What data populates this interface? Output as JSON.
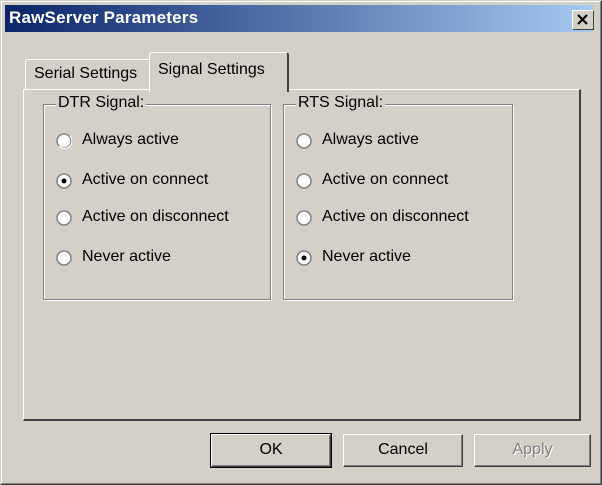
{
  "window": {
    "title": "RawServer Parameters"
  },
  "tabs": [
    {
      "label": "Serial Settings",
      "active": false
    },
    {
      "label": "Signal Settings",
      "active": true
    }
  ],
  "dtr": {
    "label": "DTR Signal:",
    "options": [
      {
        "label": "Always active",
        "checked": false
      },
      {
        "label": "Active on connect",
        "checked": true
      },
      {
        "label": "Active on disconnect",
        "checked": false
      },
      {
        "label": "Never active",
        "checked": false
      }
    ]
  },
  "rts": {
    "label": "RTS Signal:",
    "options": [
      {
        "label": "Always active",
        "checked": false
      },
      {
        "label": "Active on connect",
        "checked": false
      },
      {
        "label": "Active on disconnect",
        "checked": false
      },
      {
        "label": "Never active",
        "checked": true
      }
    ]
  },
  "buttons": {
    "ok": "OK",
    "cancel": "Cancel",
    "apply": "Apply"
  },
  "colors": {
    "title_start": "#0a246a",
    "title_end": "#a6caf0",
    "face": "#d4d0c8"
  }
}
